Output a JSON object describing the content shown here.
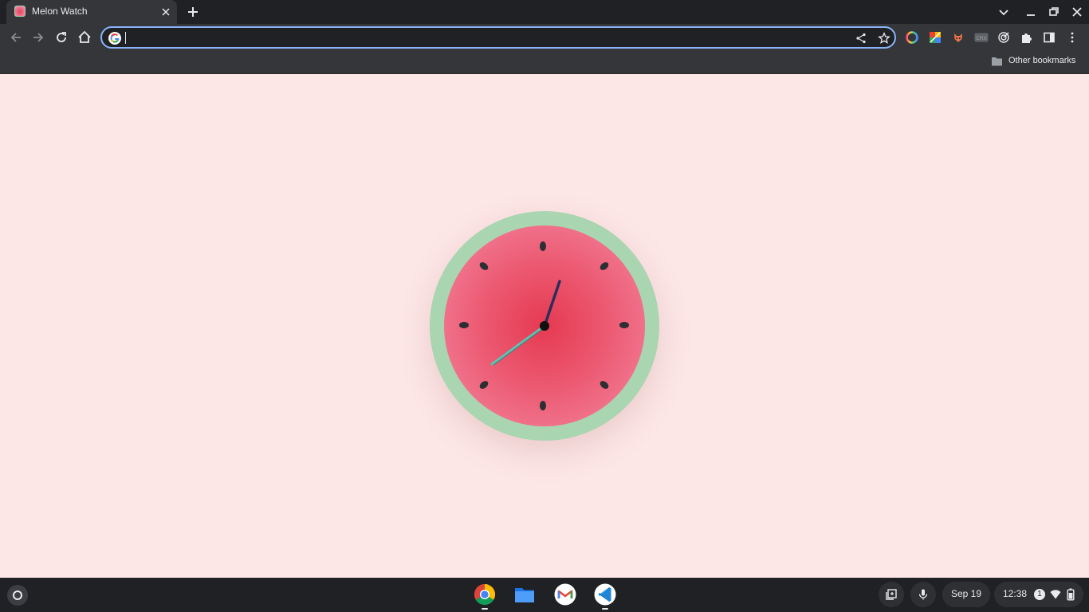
{
  "browser": {
    "tab": {
      "title": "Melon Watch",
      "favicon": "melon-favicon"
    },
    "new_tab_icon": "plus-icon",
    "window_controls": [
      "tab-search-icon",
      "minimize-icon",
      "restore-icon",
      "close-icon"
    ],
    "toolbar": {
      "nav_icons": [
        "back-icon",
        "forward-icon",
        "reload-icon",
        "home-icon"
      ],
      "omnibox": {
        "value": "",
        "placeholder": ""
      },
      "omnibox_icons": [
        "google-icon",
        "share-icon",
        "star-icon"
      ],
      "extension_icons": [
        "color-picker-icon",
        "color-grid-icon",
        "fox-extension-icon",
        "crx-icon",
        "target-icon",
        "puzzle-icon",
        "side-panel-icon",
        "menu-icon"
      ]
    },
    "bookmarks_bar": {
      "other_bookmarks": "Other bookmarks"
    }
  },
  "clock": {
    "hour_hand_color": "#2b2d5a",
    "minute_hand_color": "#5fc2b0",
    "rind_color": "#a9d5b0",
    "flesh_color": "#e53a52",
    "seed_color": "#2d2f33"
  },
  "shelf": {
    "launcher_icon": "launcher-icon",
    "apps": [
      "chrome-icon",
      "files-icon",
      "gmail-icon",
      "vscode-icon"
    ],
    "tray": {
      "date": "Sep 19",
      "time": "12:38",
      "notification_count": "1",
      "icons": [
        "screen-capture-icon",
        "microphone-icon",
        "wifi-icon",
        "battery-icon"
      ]
    }
  }
}
